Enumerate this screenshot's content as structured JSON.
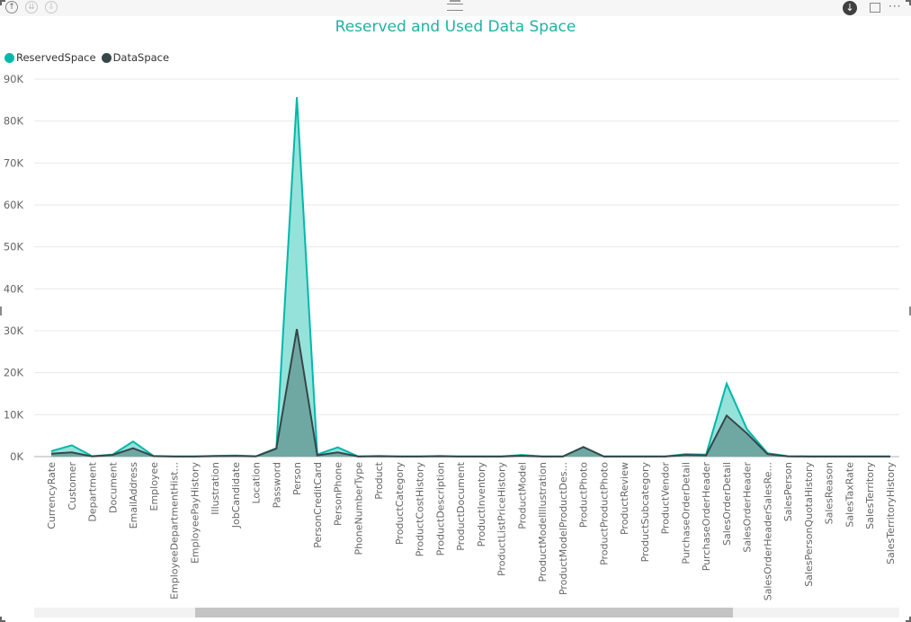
{
  "toolbar": {
    "drill_up_icon": "↑",
    "drill_down_all_icon": "⇊",
    "expand_icon": "⇩",
    "download_icon": "↓",
    "more_icon": "···"
  },
  "colors": {
    "reserved_line": "#01b8aa",
    "reserved_fill": "#8fe0d8",
    "data_line": "#374649",
    "data_fill": "#6aa29c",
    "title": "#20b2a4",
    "grid": "#e8e8e8"
  },
  "chart_data": {
    "type": "area",
    "title": "Reserved and Used Data Space",
    "xlabel": "",
    "ylabel": "",
    "ylim": [
      0,
      90000
    ],
    "yticks": [
      0,
      10000,
      20000,
      30000,
      40000,
      50000,
      60000,
      70000,
      80000,
      90000
    ],
    "ytick_labels": [
      "0K",
      "10K",
      "20K",
      "30K",
      "40K",
      "50K",
      "60K",
      "70K",
      "80K",
      "90K"
    ],
    "grid": true,
    "legend_position": "top-left",
    "categories": [
      "CurrencyRate",
      "Customer",
      "Department",
      "Document",
      "EmailAddress",
      "Employee",
      "EmployeeDepartmentHist...",
      "EmployeePayHistory",
      "Illustration",
      "JobCandidate",
      "Location",
      "Password",
      "Person",
      "PersonCreditCard",
      "PersonPhone",
      "PhoneNumberType",
      "Product",
      "ProductCategory",
      "ProductCostHistory",
      "ProductDescription",
      "ProductDocument",
      "ProductInventory",
      "ProductListPriceHistory",
      "ProductModel",
      "ProductModelIllustration",
      "ProductModelProductDes...",
      "ProductPhoto",
      "ProductProductPhoto",
      "ProductReview",
      "ProductSubcategory",
      "ProductVendor",
      "PurchaseOrderDetail",
      "PurchaseOrderHeader",
      "SalesOrderDetail",
      "SalesOrderHeader",
      "SalesOrderHeaderSalesRe...",
      "SalesPerson",
      "SalesPersonQuotaHistory",
      "SalesReason",
      "SalesTaxRate",
      "SalesTerritory",
      "SalesTerritoryHistory"
    ],
    "series": [
      {
        "name": "ReservedSpace",
        "values": [
          1300,
          2700,
          100,
          500,
          3600,
          150,
          50,
          50,
          200,
          250,
          100,
          2000,
          85700,
          500,
          2200,
          50,
          150,
          50,
          50,
          150,
          50,
          50,
          50,
          400,
          50,
          50,
          2300,
          50,
          50,
          50,
          50,
          600,
          500,
          17400,
          6500,
          800,
          100,
          50,
          50,
          50,
          50,
          50
        ]
      },
      {
        "name": "DataSpace",
        "values": [
          700,
          1000,
          50,
          400,
          2000,
          100,
          20,
          20,
          100,
          150,
          50,
          1900,
          30400,
          300,
          1000,
          20,
          80,
          20,
          20,
          80,
          20,
          20,
          20,
          200,
          20,
          20,
          2300,
          20,
          20,
          20,
          20,
          400,
          300,
          9800,
          5500,
          600,
          60,
          20,
          20,
          20,
          20,
          20
        ]
      }
    ]
  }
}
